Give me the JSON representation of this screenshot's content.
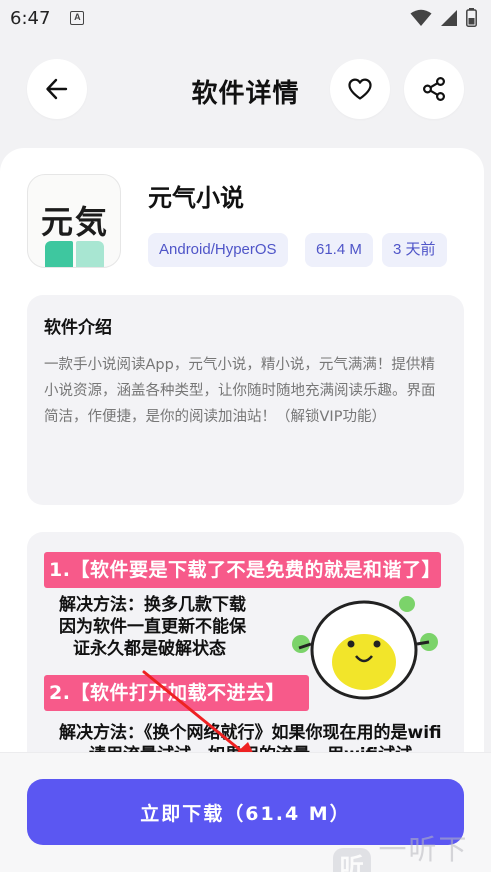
{
  "status_bar": {
    "time": "6:47",
    "notification_icon": "a-letter-icon",
    "wifi_icon": "wifi-icon",
    "signal_icon": "signal-icon",
    "battery_icon": "battery-icon"
  },
  "header": {
    "title": "软件详情",
    "back_icon": "arrow-left-icon",
    "favorite_icon": "heart-icon",
    "share_icon": "share-icon"
  },
  "app": {
    "icon_text": "元気",
    "name": "元气小说",
    "tags": [
      "Android/HyperOS",
      "61.4 M",
      "3 天前"
    ]
  },
  "intro": {
    "title": "软件介绍",
    "text": "一款手小说阅读App，元气小说，精小说，元气满满！提供精小说资源，涵盖各种类型，让你随时随地充满阅读乐趣。界面简洁，作便捷，是你的阅读加油站！（解锁VIP功能）"
  },
  "screenshot": {
    "banner1": "1.【软件要是下载了不是免费的就是和谐了】",
    "solution1_line1": "解决方法：换多几款下载",
    "solution1_line2": "因为软件一直更新不能保",
    "solution1_line3": "证永久都是破解状态",
    "banner2": "2.【软件打开加载不进去】",
    "solution2_line1": "解决方法：《换个网络就行》如果你现在用的是wifi",
    "solution2_line2": "请用流量试试，如果用的流量，用wifi试试"
  },
  "download": {
    "label": "立即下载（61.4 M）"
  },
  "watermark": {
    "logo": "听",
    "text": "一听下载"
  },
  "colors": {
    "accent": "#5b57f2",
    "tag_bg": "#eef0fb",
    "tag_text": "#4f55c8",
    "banner": "#f75a8a"
  }
}
